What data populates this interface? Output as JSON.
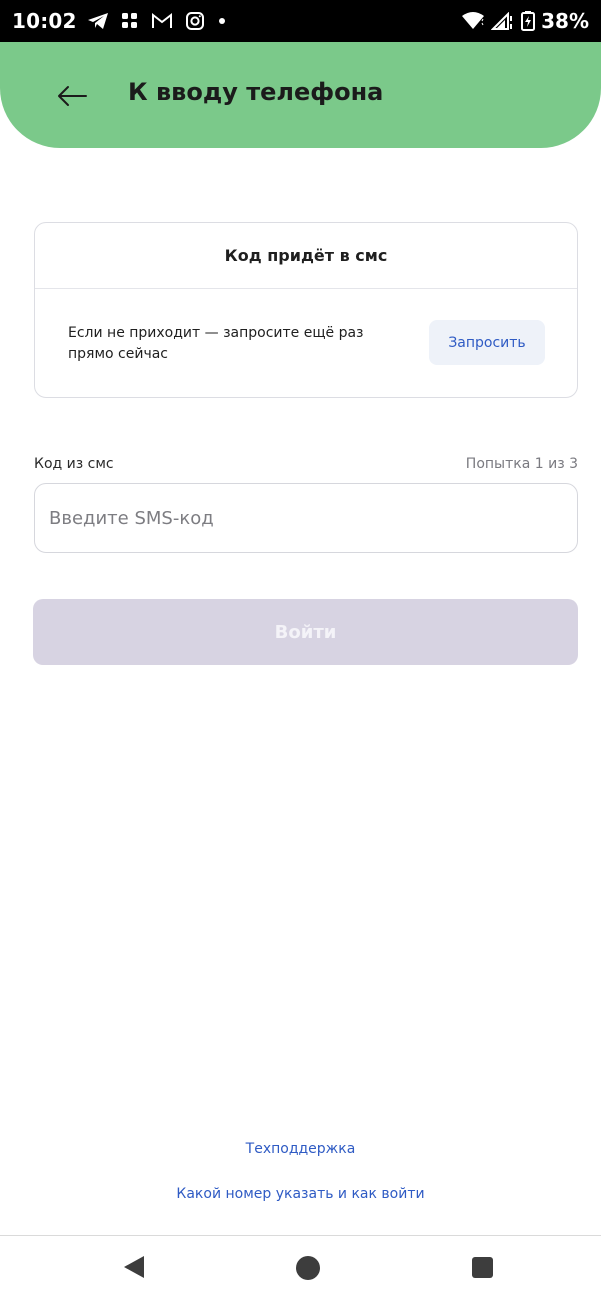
{
  "status_bar": {
    "time": "10:02",
    "battery_percent": "38%",
    "icons": [
      "telegram-icon",
      "grid-app-icon",
      "gmail-icon",
      "instagram-icon",
      "dot-icon",
      "wifi-icon",
      "signal-icon",
      "battery-icon"
    ]
  },
  "header": {
    "title": "К вводу телефона",
    "back_icon": "arrow-left-icon",
    "background_color": "#7bc98a"
  },
  "info_card": {
    "title": "Код придёт в смс",
    "text": "Если не приходит — запросите ещё раз прямо сейчас",
    "request_button": "Запросить"
  },
  "code_field": {
    "label": "Код из смс",
    "attempt": "Попытка 1 из 3",
    "placeholder": "Введите SMS-код",
    "value": ""
  },
  "submit_button": {
    "label": "Войти",
    "color": "#d7d3e2"
  },
  "footer": {
    "support_link": "Техподдержка",
    "howto_link": "Какой номер указать и как войти"
  },
  "nav_bar": {
    "icons": [
      "nav-back-icon",
      "nav-home-icon",
      "nav-recent-icon"
    ]
  },
  "colors": {
    "link": "#2f5bc4",
    "accent_green": "#7bc98a"
  }
}
